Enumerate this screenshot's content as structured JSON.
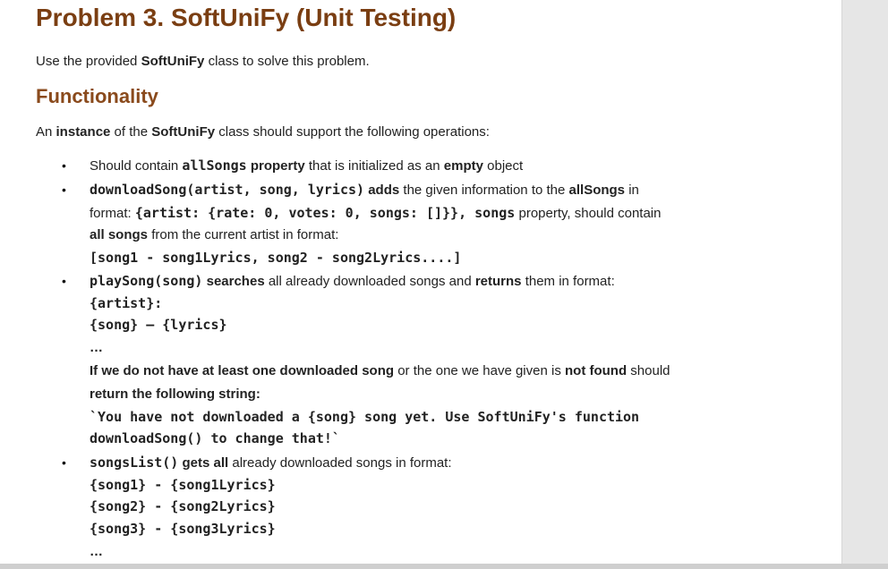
{
  "doc": {
    "title": "Problem 3. SoftUniFy (Unit Testing)",
    "intro": {
      "pre": "Use the provided ",
      "cls": "SoftUniFy",
      "post": " class to solve this problem."
    },
    "section_heading": "Functionality",
    "instance_line": {
      "a": "An ",
      "b": "instance",
      "c": " of the ",
      "d": "SoftUniFy",
      "e": " class should support the following operations:"
    },
    "bullet_glyph": "•",
    "b1": {
      "a": "Should contain ",
      "code": "allSongs",
      "b": " property",
      "c": " that is initialized as an ",
      "d": "empty",
      "e": " object"
    },
    "b2": {
      "code1": "downloadSong(artist, song, lyrics)",
      "a": " adds",
      "b": " the given information to the ",
      "c": "allSongs",
      "d": " in",
      "l2_pre": "format: ",
      "l2_code": "{artist: {rate: 0, votes: 0, songs: []}}, songs",
      "l2_post": " property, should contain",
      "l3_a": "all songs",
      "l3_b": " from the current artist in format:",
      "l4_code": "[song1 - song1Lyrics, song2 - song2Lyrics....]"
    },
    "b3": {
      "code": "playSong(song)",
      "a": " searches",
      "b": " all already downloaded songs and ",
      "c": "returns",
      "d": " them in format:",
      "l2": "{artist}:",
      "l3": "{song} – {lyrics}",
      "l4": "…",
      "l5_a": "If we do not have at least one downloaded song",
      "l5_b": " or the one we have given is ",
      "l5_c": "not found",
      "l5_d": " should",
      "l6": "return the following string:",
      "l7": "`You have not downloaded a {song} song yet. Use SoftUniFy's function",
      "l8": "downloadSong() to change that!`"
    },
    "b4": {
      "code": "songsList()",
      "a": " gets all",
      "b": " already downloaded songs in format:",
      "l2": "{song1} - {song1Lyrics}",
      "l3": "{song2} - {song2Lyrics}",
      "l4": "{song3} - {song3Lyrics}",
      "l5": "…"
    }
  }
}
